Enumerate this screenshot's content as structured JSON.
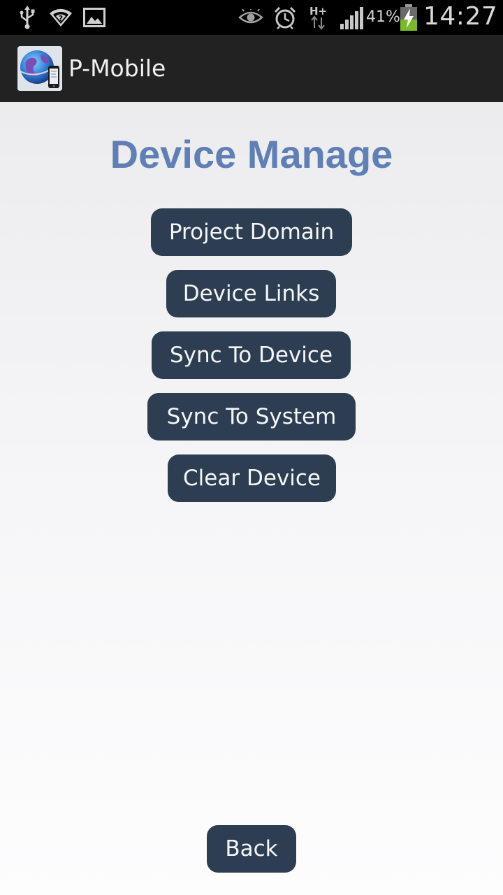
{
  "status_bar": {
    "icons": [
      "usb-icon",
      "wifi-icon",
      "image-icon",
      "eye-icon",
      "alarm-icon",
      "hplus-network-icon",
      "signal-icon",
      "battery-charging-icon"
    ],
    "network_type": "H+",
    "battery_percent": "41%",
    "time": "14:27"
  },
  "action_bar": {
    "app_icon": "globe-phone-icon",
    "title": "P-Mobile"
  },
  "main": {
    "title": "Device Manage",
    "buttons": [
      {
        "label": "Project Domain"
      },
      {
        "label": "Device Links"
      },
      {
        "label": "Sync To Device"
      },
      {
        "label": "Sync To System"
      },
      {
        "label": "Clear Device"
      }
    ],
    "back_label": "Back"
  },
  "colors": {
    "title": "#5f7fb5",
    "button_bg": "#2d3e52",
    "button_text": "#f4f6f8",
    "action_bar": "#222222",
    "status_bar": "#000000"
  }
}
